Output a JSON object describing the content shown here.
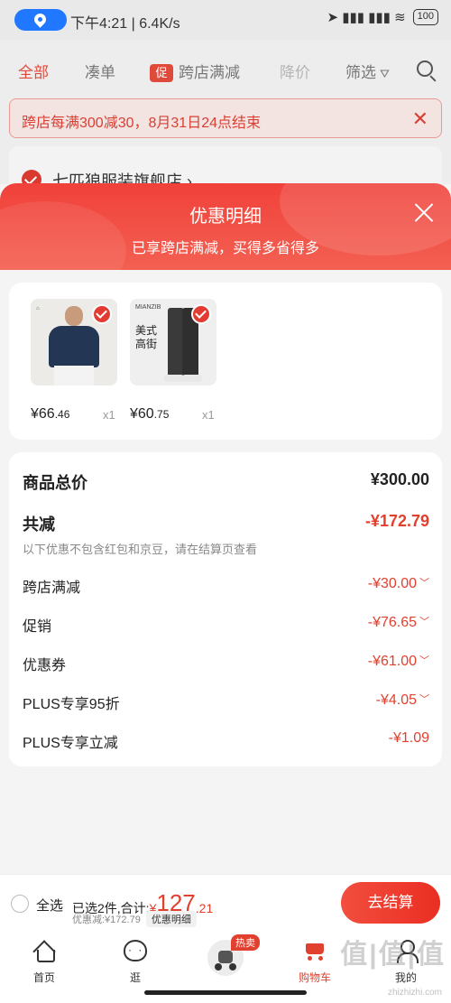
{
  "status_bar": {
    "time": "下午4:21",
    "speed": "6.4K/s",
    "battery": "100"
  },
  "background": {
    "tabs": [
      "全部",
      "凑单",
      "跨店满减",
      "降价",
      "筛选"
    ],
    "promo_icon": "促",
    "notice": "跨店每满300减30，8月31日24点结束",
    "store": "七匹狼服装旗舰店"
  },
  "sheet": {
    "title": "优惠明细",
    "subtitle": "已享跨店满减，买得多省得多",
    "products": [
      {
        "price_int": "¥66",
        "price_dec": ".46",
        "qty": "x1",
        "image_text": ""
      },
      {
        "price_int": "¥60",
        "price_dec": ".75",
        "qty": "x1",
        "image_label": "MIANZIB",
        "image_text": "美式\n高街"
      }
    ],
    "total_label": "商品总价",
    "total_value": "¥300.00",
    "reduce_label": "共减",
    "reduce_value": "-¥172.79",
    "note": "以下优惠不包含红包和京豆，请在结算页查看",
    "lines": [
      {
        "label": "跨店满减",
        "value": "-¥30.00",
        "expand": true
      },
      {
        "label": "促销",
        "value": "-¥76.65",
        "expand": true
      },
      {
        "label": "优惠券",
        "value": "-¥61.00",
        "expand": true
      },
      {
        "label": "PLUS专享95折",
        "value": "-¥4.05",
        "expand": true
      },
      {
        "label": "PLUS专享立减",
        "value": "-¥1.09",
        "expand": false
      }
    ]
  },
  "checkout": {
    "select_all": "全选",
    "summary_prefix": "已选2件,合计:",
    "currency": "¥",
    "amount_int": "127",
    "amount_dec": ".21",
    "discount_text": "优惠减:¥172.79",
    "detail_chip": "优惠明细",
    "button": "去结算"
  },
  "tabbar": {
    "items": [
      {
        "label": "首页",
        "icon": "home-icon"
      },
      {
        "label": "逛",
        "icon": "face-icon"
      },
      {
        "label": "",
        "icon": "scooter-icon",
        "badge": "热卖"
      },
      {
        "label": "购物车",
        "icon": "cart-icon"
      },
      {
        "label": "我的",
        "icon": "me-icon"
      }
    ]
  },
  "watermark": {
    "main": "值|值|值",
    "sub": "zhizhizhi.com"
  },
  "colors": {
    "accent": "#e2402f",
    "header_red": "#f0413a"
  }
}
